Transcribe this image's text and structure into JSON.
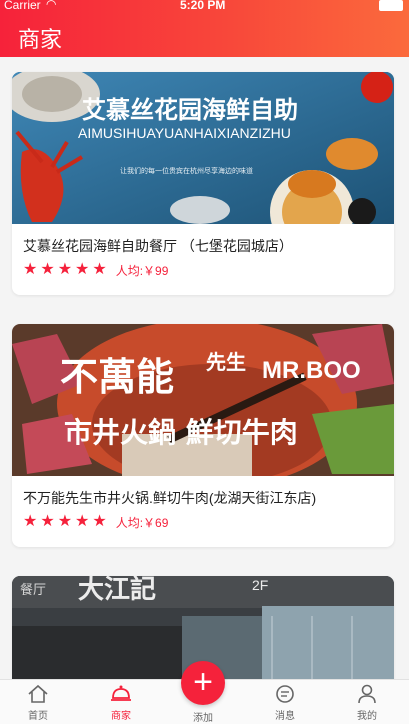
{
  "status_bar": {
    "carrier": "Carrier",
    "time": "5:20 PM"
  },
  "header": {
    "title": "商家"
  },
  "merchants": [
    {
      "name": "艾慕丝花园海鲜自助餐厅 （七堡花园城店）",
      "banner_title": "艾慕丝花园海鲜自助",
      "banner_pinyin": "AIMUSIHUAYUANHAIXIANZIZHU",
      "banner_tagline": "让我们的每一位贵宾在杭州尽享海边的味道",
      "stars": 5,
      "price": "人均:￥99"
    },
    {
      "name": "不万能先生市井火锅.鲜切牛肉(龙湖天街江东店)",
      "banner_title": "不萬能",
      "banner_sub1": "先生",
      "banner_sub2": "MR.BOO",
      "banner_slogan": "市井火鍋 鮮切牛肉",
      "stars": 5,
      "price": "人均:￥69"
    },
    {
      "banner_title": "大江記",
      "banner_floor": "2F",
      "banner_side": "餐厅"
    }
  ],
  "tabbar": {
    "items": [
      {
        "label": "首页",
        "icon": "home-icon"
      },
      {
        "label": "商家",
        "icon": "dish-icon",
        "active": true
      },
      {
        "label": "添加",
        "icon": "plus-icon"
      },
      {
        "label": "消息",
        "icon": "chat-icon"
      },
      {
        "label": "我的",
        "icon": "user-icon"
      }
    ]
  },
  "colors": {
    "accent": "#f5213b",
    "header_start": "#f6223a",
    "header_end": "#fb6a3c"
  }
}
